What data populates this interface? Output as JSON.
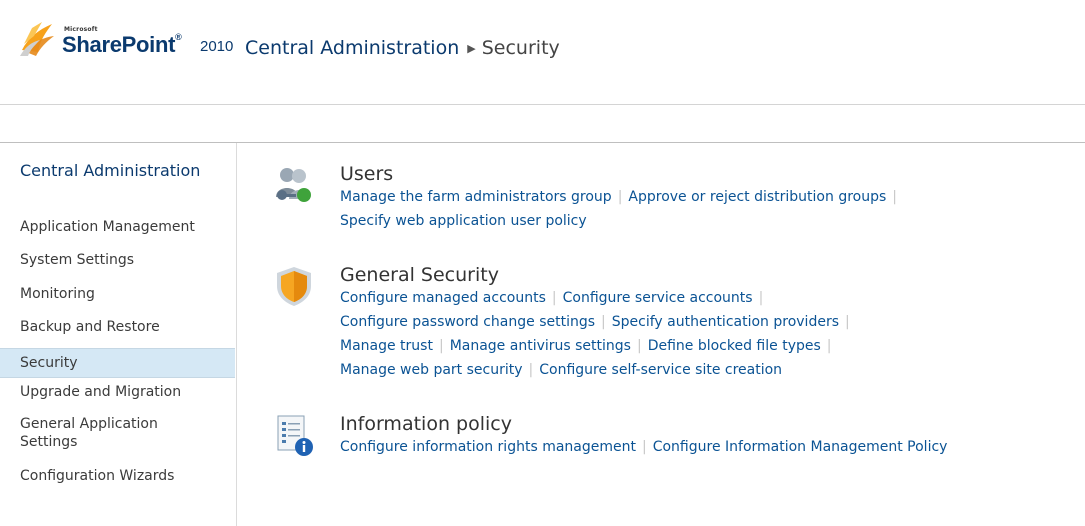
{
  "brand": {
    "microsoft": "Microsoft",
    "product": "SharePoint",
    "trademark": "®",
    "year": "2010"
  },
  "header": {
    "title": "Central Administration",
    "breadcrumb_current": "Security"
  },
  "sidebar": {
    "home": "Central Administration",
    "items": [
      {
        "label": "Application Management"
      },
      {
        "label": "System Settings"
      },
      {
        "label": "Monitoring"
      },
      {
        "label": "Backup and Restore"
      },
      {
        "label": "Security"
      },
      {
        "label": "Upgrade and Migration"
      },
      {
        "label": "General Application Settings"
      },
      {
        "label": "Configuration Wizards"
      }
    ],
    "selected_index": 4
  },
  "sections": [
    {
      "title": "Users",
      "icon": "users-icon",
      "lines": [
        [
          "Manage the farm administrators group",
          "Approve or reject distribution groups"
        ],
        [
          "Specify web application user policy"
        ]
      ]
    },
    {
      "title": "General Security",
      "icon": "shield-icon",
      "lines": [
        [
          "Configure managed accounts",
          "Configure service accounts"
        ],
        [
          "Configure password change settings",
          "Specify authentication providers"
        ],
        [
          "Manage trust",
          "Manage antivirus settings",
          "Define blocked file types"
        ],
        [
          "Manage web part security",
          "Configure self-service site creation"
        ]
      ]
    },
    {
      "title": "Information policy",
      "icon": "information-policy-icon",
      "lines": [
        [
          "Configure information rights management",
          "Configure Information Management Policy"
        ]
      ]
    }
  ],
  "separator": "|",
  "colors": {
    "title_blue": "#0b3a6e",
    "link_blue": "#0b5394",
    "selected_bg": "#d5e8f5"
  }
}
